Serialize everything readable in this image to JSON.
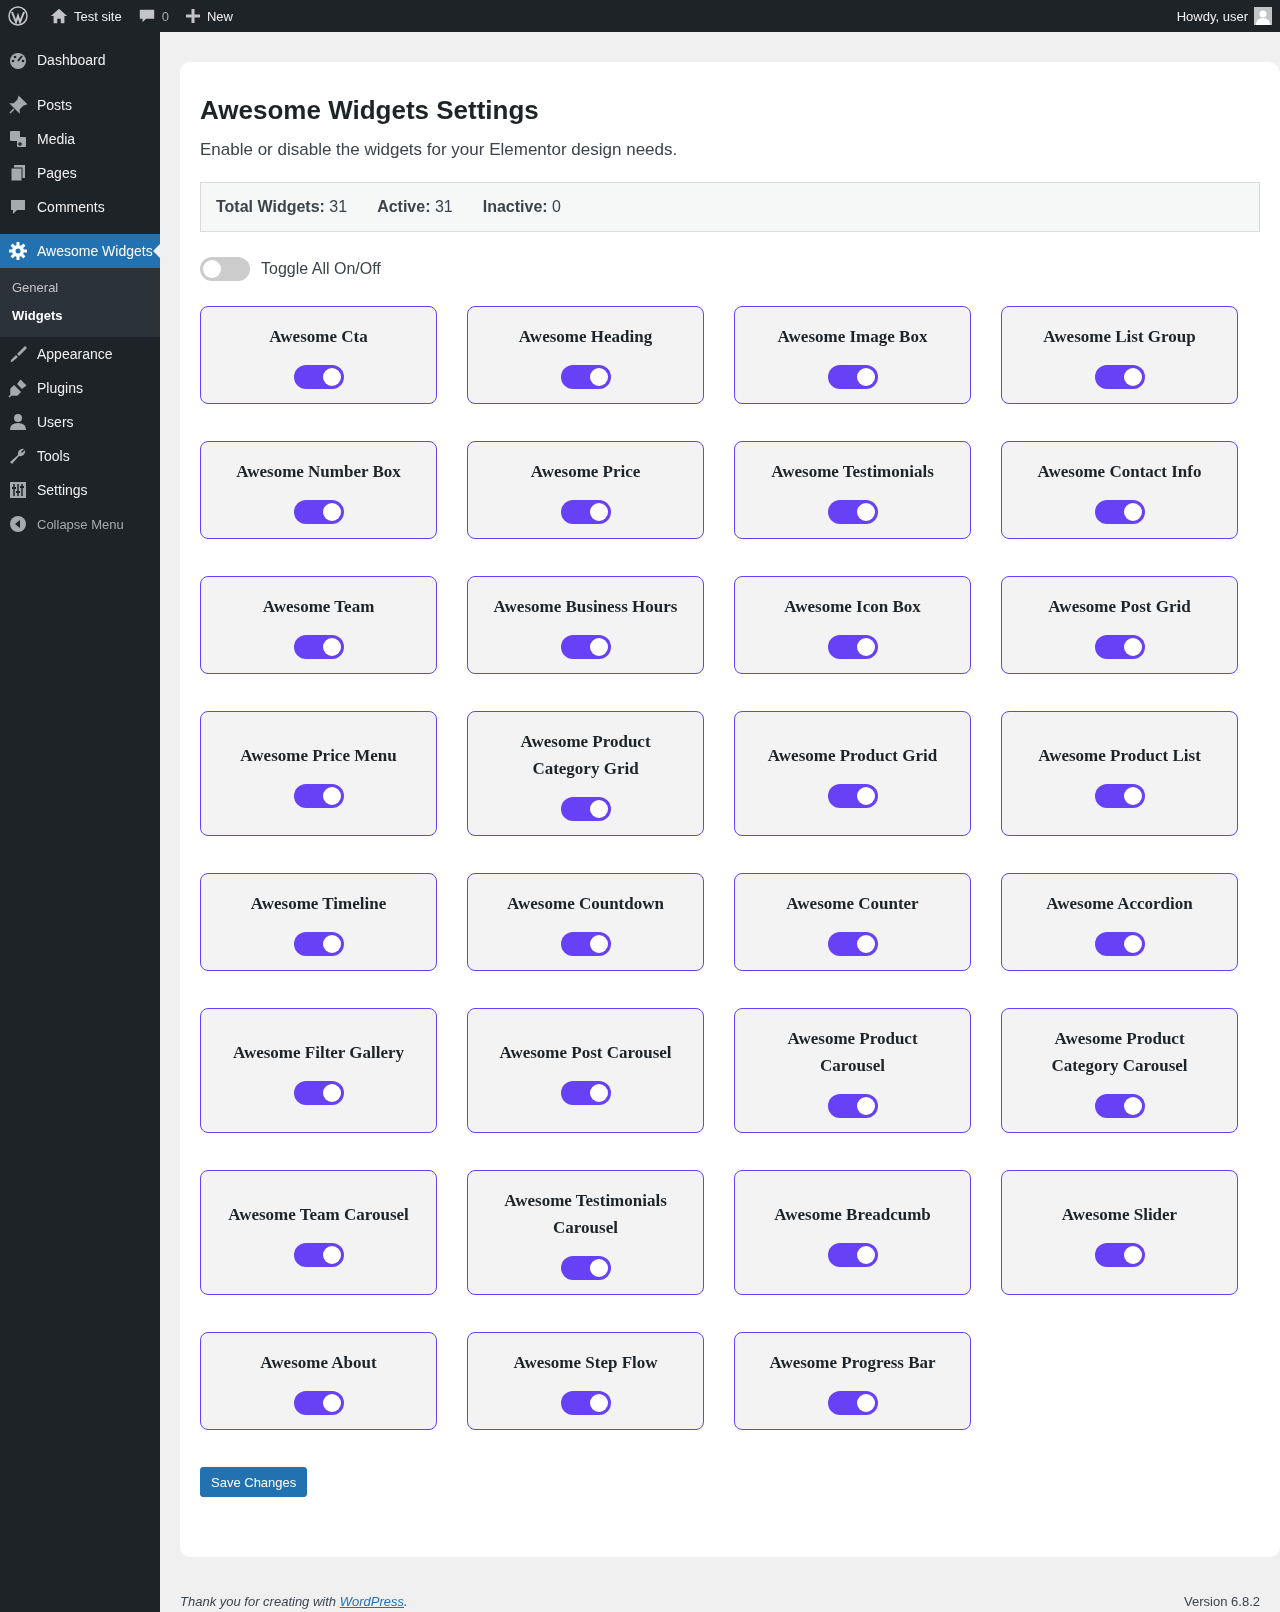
{
  "topbar": {
    "site": "Test site",
    "comments": "0",
    "new": "New",
    "greeting": "Howdy, user"
  },
  "sidebar": {
    "items": [
      {
        "label": "Dashboard",
        "kind": "dashboard",
        "selected": false
      },
      {
        "label": "Posts",
        "kind": "pin",
        "selected": false
      },
      {
        "label": "Media",
        "kind": "media",
        "selected": false
      },
      {
        "label": "Pages",
        "kind": "pages",
        "selected": false
      },
      {
        "label": "Comments",
        "kind": "comment",
        "selected": false
      },
      {
        "label": "Awesome Widgets",
        "kind": "gear",
        "selected": true,
        "children": [
          {
            "label": "General",
            "selected": false
          },
          {
            "label": "Widgets",
            "selected": true
          }
        ]
      },
      {
        "label": "Appearance",
        "kind": "brush",
        "selected": false
      },
      {
        "label": "Plugins",
        "kind": "plug",
        "selected": false
      },
      {
        "label": "Users",
        "kind": "user",
        "selected": false
      },
      {
        "label": "Tools",
        "kind": "wrench",
        "selected": false
      },
      {
        "label": "Settings",
        "kind": "sliders",
        "selected": false
      }
    ],
    "collapse": "Collapse Menu"
  },
  "page": {
    "title": "Awesome Widgets Settings",
    "description": "Enable or disable the widgets for your Elementor design needs.",
    "stats": [
      "**Total Widgets:** 31",
      "**Active:** 31",
      "**Inactive:** 0"
    ],
    "toggle_all": {
      "label": "Toggle All On/Off",
      "on": false
    },
    "widgets": [
      {
        "name": "Awesome Cta",
        "on": true
      },
      {
        "name": "Awesome Heading",
        "on": true
      },
      {
        "name": "Awesome Image Box",
        "on": true
      },
      {
        "name": "Awesome List Group",
        "on": true
      },
      {
        "name": "Awesome Number Box",
        "on": true
      },
      {
        "name": "Awesome Price",
        "on": true
      },
      {
        "name": "Awesome Testimonials",
        "on": true
      },
      {
        "name": "Awesome Contact Info",
        "on": true
      },
      {
        "name": "Awesome Team",
        "on": true
      },
      {
        "name": "Awesome Business Hours",
        "on": true
      },
      {
        "name": "Awesome Icon Box",
        "on": true
      },
      {
        "name": "Awesome Post Grid",
        "on": true
      },
      {
        "name": "Awesome Price Menu",
        "on": true
      },
      {
        "name": "Awesome Product Category Grid",
        "on": true
      },
      {
        "name": "Awesome Product Grid",
        "on": true
      },
      {
        "name": "Awesome Product List",
        "on": true
      },
      {
        "name": "Awesome Timeline",
        "on": true
      },
      {
        "name": "Awesome Countdown",
        "on": true
      },
      {
        "name": "Awesome Counter",
        "on": true
      },
      {
        "name": "Awesome Accordion",
        "on": true
      },
      {
        "name": "Awesome Filter Gallery",
        "on": true
      },
      {
        "name": "Awesome Post Carousel",
        "on": true
      },
      {
        "name": "Awesome Product Carousel",
        "on": true
      },
      {
        "name": "Awesome Product Category Carousel",
        "on": true
      },
      {
        "name": "Awesome Team Carousel",
        "on": true
      },
      {
        "name": "Awesome Testimonials Carousel",
        "on": true
      },
      {
        "name": "Awesome Breadcumb",
        "on": true
      },
      {
        "name": "Awesome Slider",
        "on": true
      },
      {
        "name": "Awesome About",
        "on": true
      },
      {
        "name": "Awesome Step Flow",
        "on": true
      },
      {
        "name": "Awesome Progress Bar",
        "on": true
      }
    ],
    "save": "Save Changes"
  },
  "footer": {
    "before": "Thank you for creating with ",
    "link": "WordPress",
    "after": ".",
    "version": "Version 6.8.2"
  }
}
